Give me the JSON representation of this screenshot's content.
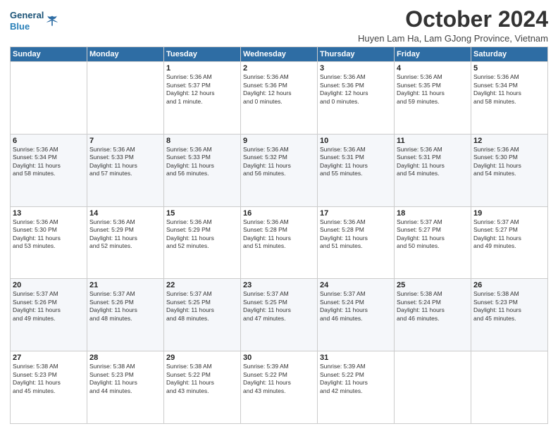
{
  "header": {
    "logo_general": "General",
    "logo_blue": "Blue",
    "month_title": "October 2024",
    "subtitle": "Huyen Lam Ha, Lam GJong Province, Vietnam"
  },
  "weekdays": [
    "Sunday",
    "Monday",
    "Tuesday",
    "Wednesday",
    "Thursday",
    "Friday",
    "Saturday"
  ],
  "weeks": [
    [
      {
        "day": "",
        "info": ""
      },
      {
        "day": "",
        "info": ""
      },
      {
        "day": "1",
        "info": "Sunrise: 5:36 AM\nSunset: 5:37 PM\nDaylight: 12 hours\nand 1 minute."
      },
      {
        "day": "2",
        "info": "Sunrise: 5:36 AM\nSunset: 5:36 PM\nDaylight: 12 hours\nand 0 minutes."
      },
      {
        "day": "3",
        "info": "Sunrise: 5:36 AM\nSunset: 5:36 PM\nDaylight: 12 hours\nand 0 minutes."
      },
      {
        "day": "4",
        "info": "Sunrise: 5:36 AM\nSunset: 5:35 PM\nDaylight: 11 hours\nand 59 minutes."
      },
      {
        "day": "5",
        "info": "Sunrise: 5:36 AM\nSunset: 5:34 PM\nDaylight: 11 hours\nand 58 minutes."
      }
    ],
    [
      {
        "day": "6",
        "info": "Sunrise: 5:36 AM\nSunset: 5:34 PM\nDaylight: 11 hours\nand 58 minutes."
      },
      {
        "day": "7",
        "info": "Sunrise: 5:36 AM\nSunset: 5:33 PM\nDaylight: 11 hours\nand 57 minutes."
      },
      {
        "day": "8",
        "info": "Sunrise: 5:36 AM\nSunset: 5:33 PM\nDaylight: 11 hours\nand 56 minutes."
      },
      {
        "day": "9",
        "info": "Sunrise: 5:36 AM\nSunset: 5:32 PM\nDaylight: 11 hours\nand 56 minutes."
      },
      {
        "day": "10",
        "info": "Sunrise: 5:36 AM\nSunset: 5:31 PM\nDaylight: 11 hours\nand 55 minutes."
      },
      {
        "day": "11",
        "info": "Sunrise: 5:36 AM\nSunset: 5:31 PM\nDaylight: 11 hours\nand 54 minutes."
      },
      {
        "day": "12",
        "info": "Sunrise: 5:36 AM\nSunset: 5:30 PM\nDaylight: 11 hours\nand 54 minutes."
      }
    ],
    [
      {
        "day": "13",
        "info": "Sunrise: 5:36 AM\nSunset: 5:30 PM\nDaylight: 11 hours\nand 53 minutes."
      },
      {
        "day": "14",
        "info": "Sunrise: 5:36 AM\nSunset: 5:29 PM\nDaylight: 11 hours\nand 52 minutes."
      },
      {
        "day": "15",
        "info": "Sunrise: 5:36 AM\nSunset: 5:29 PM\nDaylight: 11 hours\nand 52 minutes."
      },
      {
        "day": "16",
        "info": "Sunrise: 5:36 AM\nSunset: 5:28 PM\nDaylight: 11 hours\nand 51 minutes."
      },
      {
        "day": "17",
        "info": "Sunrise: 5:36 AM\nSunset: 5:28 PM\nDaylight: 11 hours\nand 51 minutes."
      },
      {
        "day": "18",
        "info": "Sunrise: 5:37 AM\nSunset: 5:27 PM\nDaylight: 11 hours\nand 50 minutes."
      },
      {
        "day": "19",
        "info": "Sunrise: 5:37 AM\nSunset: 5:27 PM\nDaylight: 11 hours\nand 49 minutes."
      }
    ],
    [
      {
        "day": "20",
        "info": "Sunrise: 5:37 AM\nSunset: 5:26 PM\nDaylight: 11 hours\nand 49 minutes."
      },
      {
        "day": "21",
        "info": "Sunrise: 5:37 AM\nSunset: 5:26 PM\nDaylight: 11 hours\nand 48 minutes."
      },
      {
        "day": "22",
        "info": "Sunrise: 5:37 AM\nSunset: 5:25 PM\nDaylight: 11 hours\nand 48 minutes."
      },
      {
        "day": "23",
        "info": "Sunrise: 5:37 AM\nSunset: 5:25 PM\nDaylight: 11 hours\nand 47 minutes."
      },
      {
        "day": "24",
        "info": "Sunrise: 5:37 AM\nSunset: 5:24 PM\nDaylight: 11 hours\nand 46 minutes."
      },
      {
        "day": "25",
        "info": "Sunrise: 5:38 AM\nSunset: 5:24 PM\nDaylight: 11 hours\nand 46 minutes."
      },
      {
        "day": "26",
        "info": "Sunrise: 5:38 AM\nSunset: 5:23 PM\nDaylight: 11 hours\nand 45 minutes."
      }
    ],
    [
      {
        "day": "27",
        "info": "Sunrise: 5:38 AM\nSunset: 5:23 PM\nDaylight: 11 hours\nand 45 minutes."
      },
      {
        "day": "28",
        "info": "Sunrise: 5:38 AM\nSunset: 5:23 PM\nDaylight: 11 hours\nand 44 minutes."
      },
      {
        "day": "29",
        "info": "Sunrise: 5:38 AM\nSunset: 5:22 PM\nDaylight: 11 hours\nand 43 minutes."
      },
      {
        "day": "30",
        "info": "Sunrise: 5:39 AM\nSunset: 5:22 PM\nDaylight: 11 hours\nand 43 minutes."
      },
      {
        "day": "31",
        "info": "Sunrise: 5:39 AM\nSunset: 5:22 PM\nDaylight: 11 hours\nand 42 minutes."
      },
      {
        "day": "",
        "info": ""
      },
      {
        "day": "",
        "info": ""
      }
    ]
  ]
}
